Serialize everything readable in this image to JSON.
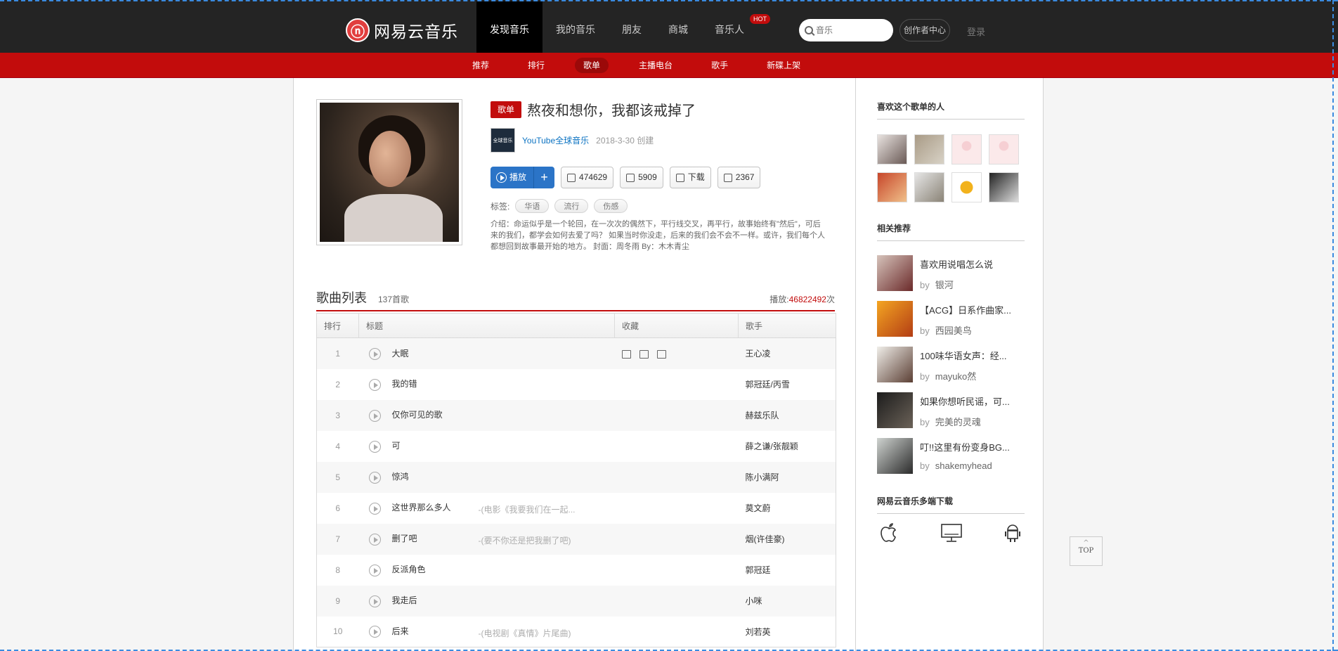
{
  "header": {
    "logo_text": "网易云音乐",
    "nav": [
      "发现音乐",
      "我的音乐",
      "朋友",
      "商城",
      "音乐人"
    ],
    "hot_badge": "HOT",
    "search_placeholder": "音乐",
    "creator_center": "创作者中心",
    "login": "登录"
  },
  "subnav": [
    "推荐",
    "排行",
    "歌单",
    "主播电台",
    "歌手",
    "新碟上架"
  ],
  "playlist": {
    "tag": "歌单",
    "title": "熬夜和想你，我都该戒掉了",
    "creator_avatar_text": "全球音乐",
    "creator": "YouTube全球音乐",
    "created": "2018-3-30 创建",
    "play_label": "播放",
    "plus": "+",
    "fav_count": "474629",
    "share_count": "5909",
    "download_label": "下载",
    "comment_count": "2367",
    "labels_title": "标签:",
    "labels": [
      "华语",
      "流行",
      "伤感"
    ],
    "desc": "介绍：命运似乎是一个轮回，在一次次的偶然下，平行线交叉，再平行，故事始终有\"然后\"，可后来的我们，都学会如何去爱了吗？ 如果当时你没走，后来的我们会不会不一样。或许，我们每个人都想回到故事最开始的地方。 封面：周冬雨 By：木木青尘"
  },
  "songlist": {
    "title": "歌曲列表",
    "count": "137首歌",
    "play_label": "播放:",
    "play_count": "46822492",
    "play_suffix": "次",
    "headers": [
      "排行",
      "标题",
      "收藏",
      "歌手"
    ],
    "rows": [
      {
        "idx": "1",
        "title": "大眠",
        "sub": "",
        "artist": "王心凌"
      },
      {
        "idx": "2",
        "title": "我的错",
        "sub": "",
        "artist": "郭冠廷/丙雪"
      },
      {
        "idx": "3",
        "title": "仅你可见的歌",
        "sub": "",
        "artist": "赫兹乐队"
      },
      {
        "idx": "4",
        "title": "可",
        "sub": "",
        "artist": "薛之谦/张靓颖"
      },
      {
        "idx": "5",
        "title": "惊鸿",
        "sub": "",
        "artist": "陈小满阿"
      },
      {
        "idx": "6",
        "title": "这世界那么多人",
        "sub": "-(电影《我要我们在一起...",
        "artist": "莫文蔚"
      },
      {
        "idx": "7",
        "title": "删了吧",
        "sub": "-(要不你还是把我删了吧)",
        "artist": "烟(许佳豪)"
      },
      {
        "idx": "8",
        "title": "反派角色",
        "sub": "",
        "artist": "郭冠廷"
      },
      {
        "idx": "9",
        "title": "我走后",
        "sub": "",
        "artist": "小咪"
      },
      {
        "idx": "10",
        "title": "后来",
        "sub": "-(电视剧《真情》片尾曲)",
        "artist": "刘若英"
      }
    ]
  },
  "sidebar": {
    "likers_title": "喜欢这个歌单的人",
    "related_title": "相关推荐",
    "related": [
      {
        "name": "喜欢用说唱怎么说",
        "by": "by",
        "author": "银河"
      },
      {
        "name": "【ACG】日系作曲家...",
        "by": "by",
        "author": "西园美鸟"
      },
      {
        "name": "100味华语女声：经...",
        "by": "by",
        "author": "mayuko然"
      },
      {
        "name": "如果你想听民谣，可...",
        "by": "by",
        "author": "完美的灵魂"
      },
      {
        "name": "叮!!这里有份变身BG...",
        "by": "by",
        "author": "shakemyhead"
      }
    ],
    "download_title": "网易云音乐多端下载"
  },
  "top_button": "TOP",
  "colors": {
    "brand_red": "#c20c0c",
    "dark": "#242424",
    "link_blue": "#0c73c2",
    "play_blue": "#2b74c7"
  }
}
